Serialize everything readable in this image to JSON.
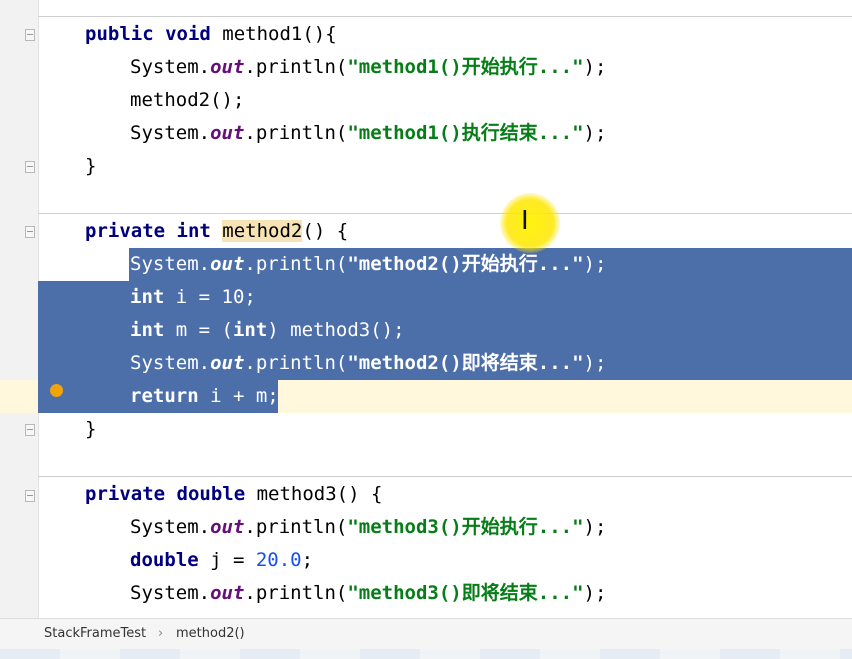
{
  "editor": {
    "method1": {
      "signature": {
        "kw": "public void",
        "name": "method1(){"
      },
      "lines": [
        {
          "pre": "System.",
          "field": "out",
          "call": ".println(",
          "str": "\"method1()开始执行...\"",
          "post": ");"
        },
        {
          "plain": "method2();"
        },
        {
          "pre": "System.",
          "field": "out",
          "call": ".println(",
          "str": "\"method1()执行结束...\"",
          "post": ");"
        }
      ],
      "close": "}"
    },
    "method2": {
      "signature": {
        "kw": "private int",
        "name": "method2",
        "rest": "() {"
      },
      "line1": {
        "pre": "System.",
        "field": "out",
        "call": ".println(",
        "str": "\"method2()开始执行...\"",
        "post": ");"
      },
      "line2": {
        "kw": "int",
        "rest": " i = 10;"
      },
      "line3": {
        "kw": "int",
        "mid": " m = (",
        "kw2": "int",
        "rest": ") method3();"
      },
      "line4": {
        "pre": "System.",
        "field": "out",
        "call": ".println(",
        "str": "\"method2()即将结束...\"",
        "post": ");"
      },
      "line5": {
        "kw": "return",
        "rest": " i + m;"
      },
      "close": "}"
    },
    "method3": {
      "signature": {
        "kw": "private double",
        "name": "method3() {"
      },
      "line1": {
        "pre": "System.",
        "field": "out",
        "call": ".println(",
        "str": "\"method3()开始执行...\"",
        "post": ");"
      },
      "line2": {
        "kw": "double",
        "mid": " j = ",
        "num": "20.0",
        "rest": ";"
      },
      "line3": {
        "pre": "System.",
        "field": "out",
        "call": ".println(",
        "str": "\"method3()即将结束...\"",
        "post": ");"
      }
    }
  },
  "breadcrumb": {
    "class": "StackFrameTest",
    "separator": "›",
    "method": "method2()"
  },
  "colors": {
    "selection": "#4d6fa9",
    "keyword": "#000080",
    "string": "#067d17",
    "field": "#660e7a",
    "breakpoint": "#f0a30a"
  }
}
